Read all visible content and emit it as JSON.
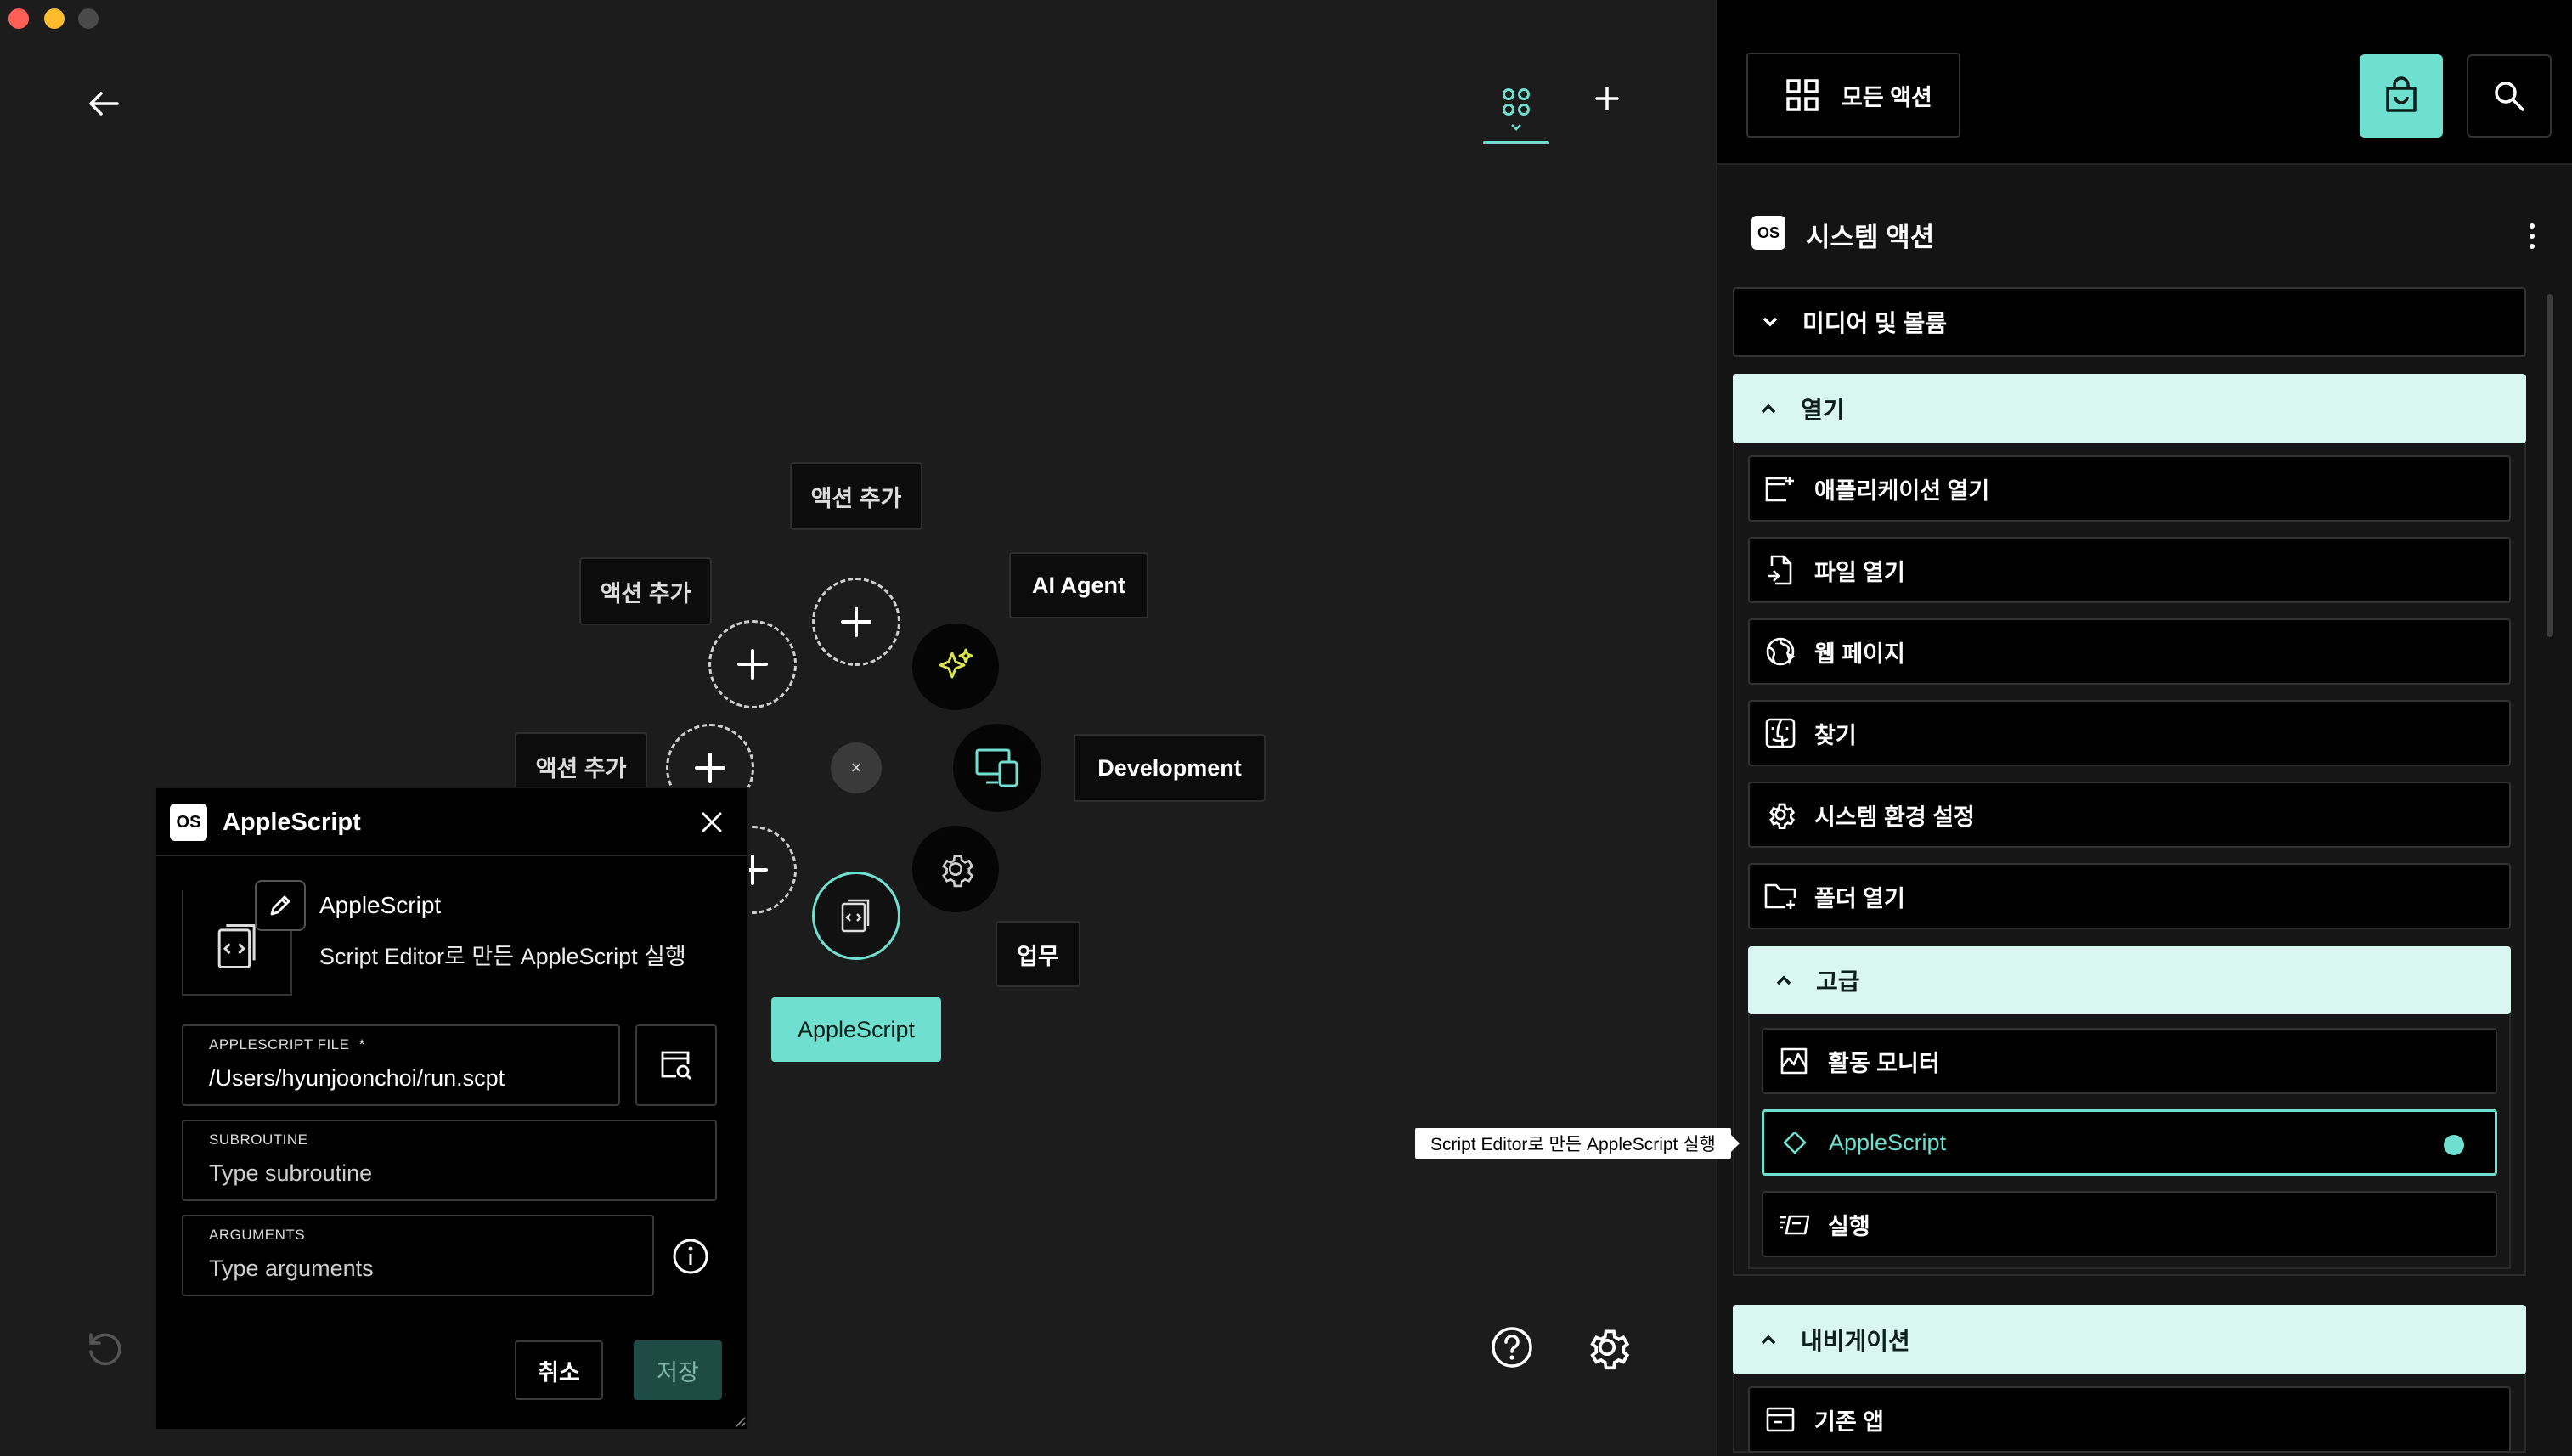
{
  "canvas": {
    "add_action_label": "액션 추가",
    "categories": {
      "ai_agent": "AI Agent",
      "development": "Development",
      "work": "업무"
    },
    "selected_action_label": "AppleScript",
    "center_close": "×"
  },
  "dialog": {
    "badge": "OS",
    "title": "AppleScript",
    "action_name": "AppleScript",
    "action_description": "Script Editor로 만든 AppleScript 실행",
    "file_field": {
      "label": "APPLESCRIPT FILE",
      "required_mark": "*",
      "value": "/Users/hyunjoonchoi/run.scpt"
    },
    "subroutine_field": {
      "label": "SUBROUTINE",
      "placeholder": "Type subroutine"
    },
    "arguments_field": {
      "label": "ARGUMENTS",
      "placeholder": "Type arguments"
    },
    "cancel_label": "취소",
    "save_label": "저장"
  },
  "panel": {
    "all_actions_label": "모든 액션",
    "section_badge": "OS",
    "section_title": "시스템 액션",
    "groups": [
      {
        "label": "미디어 및 볼륨",
        "expanded": false
      },
      {
        "label": "열기",
        "expanded": true,
        "items": [
          {
            "label": "애플리케이션 열기",
            "icon": "app-window-icon"
          },
          {
            "label": "파일 열기",
            "icon": "file-open-icon"
          },
          {
            "label": "웹 페이지",
            "icon": "globe-icon"
          },
          {
            "label": "찾기",
            "icon": "finder-icon"
          },
          {
            "label": "시스템 환경 설정",
            "icon": "gear-icon"
          },
          {
            "label": "폴더 열기",
            "icon": "folder-icon"
          }
        ],
        "subgroup": {
          "label": "고급",
          "items": [
            {
              "label": "활동 모니터",
              "icon": "activity-monitor-icon"
            },
            {
              "label": "AppleScript",
              "icon": "diamond-icon",
              "selected": true
            },
            {
              "label": "실행",
              "icon": "run-icon"
            }
          ]
        }
      },
      {
        "label": "내비게이션",
        "expanded": true,
        "items": [
          {
            "label": "기존 앱",
            "icon": "window-icon"
          }
        ]
      }
    ],
    "tooltip": "Script Editor로 만든 AppleScript 실행"
  },
  "colors": {
    "accent": "#6fe0cf",
    "background": "#1c1c1c",
    "panel_background": "#141414",
    "expanded_header": "#d9f6f1",
    "ai_icon": "#d9e64a"
  }
}
